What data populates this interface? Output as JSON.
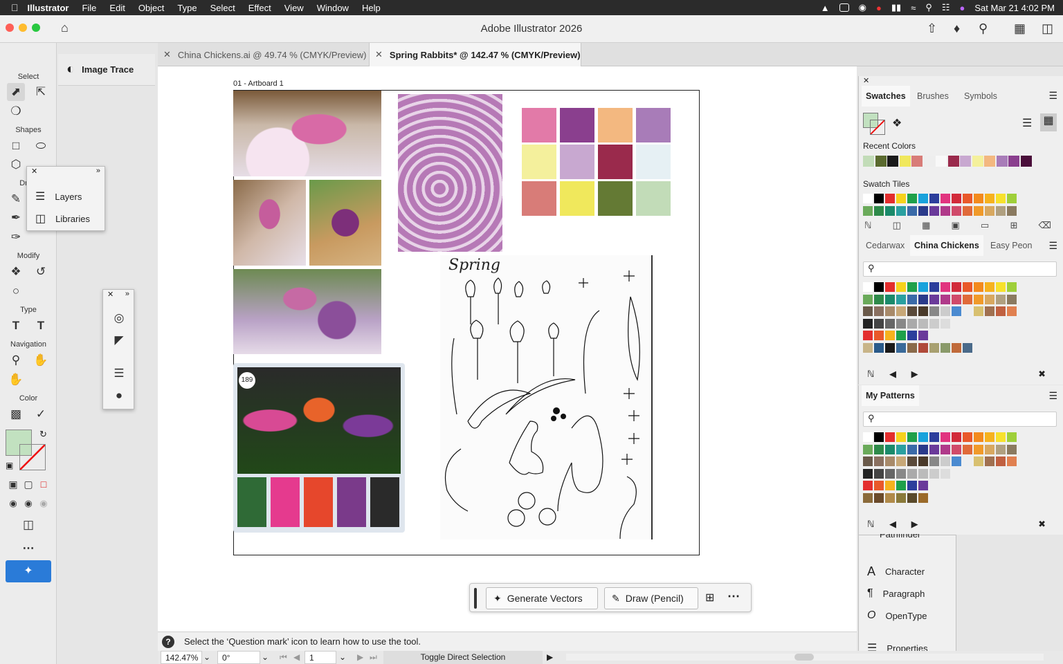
{
  "menubar": {
    "app": "Illustrator",
    "items": [
      "File",
      "Edit",
      "Object",
      "Type",
      "Select",
      "Effect",
      "View",
      "Window",
      "Help"
    ],
    "datetime": "Sat Mar 21  4:02 PM"
  },
  "window": {
    "title": "Adobe Illustrator 2026"
  },
  "tabs": [
    {
      "label": "China Chickens.ai @ 49.74 % (CMYK/Preview)"
    },
    {
      "label": "Spring Rabbits* @ 142.47 % (CMYK/Preview)"
    }
  ],
  "toolbar": {
    "sections": {
      "select": "Select",
      "shapes": "Shapes",
      "draw": "Dr",
      "modify": "Modify",
      "type": "Type",
      "navigation": "Navigation",
      "color": "Color"
    },
    "colors": {
      "fill": "#c2e1c0",
      "stroke": "none"
    }
  },
  "properties": {
    "image_trace": "Image Trace"
  },
  "layers_panel": {
    "layers": "Layers",
    "libraries": "Libraries"
  },
  "artboard": {
    "name": "01 - Artboard 1",
    "sketch_title": "Spring",
    "badge": "189"
  },
  "moodboard_swatches": [
    "#e27aa8",
    "#8a3f8e",
    "#f3b880",
    "#a87cb8",
    "#f4f09c",
    "#c8a8d0",
    "#9a2a4c",
    "#e6f0f4",
    "#d87c78",
    "#f0e85c",
    "#647a34",
    "#c2dcb8"
  ],
  "photo_card_swatches": [
    "#2f6a36",
    "#e53a8e",
    "#e6472c",
    "#7a3a8a",
    "#2a2a2a"
  ],
  "swatches_panel": {
    "tabs": [
      "Swatches",
      "Brushes",
      "Symbols"
    ],
    "recent_label": "Recent Colors",
    "recent": [
      "#c2dcb8",
      "#5a6a2e",
      "#1a1a1a",
      "#f0e85c",
      "#d87c78",
      "#eeeeee",
      "#f8f8f8",
      "#9a2a4c",
      "#c8a8d0",
      "#f4f09c",
      "#f3b880",
      "#a87cb8",
      "#8a3f8e",
      "#4a0e3a"
    ],
    "tiles_label": "Swatch Tiles"
  },
  "library_panel": {
    "tabs": [
      "Cedarwax",
      "China Chickens",
      "Easy Peon"
    ]
  },
  "patterns_panel": {
    "title": "My Patterns"
  },
  "type_panels": {
    "character": "Character",
    "paragraph": "Paragraph",
    "opentype": "OpenType",
    "properties": "Properties",
    "pathfinder": "Pathfinder"
  },
  "context_bar": {
    "generate": "Generate Vectors",
    "draw": "Draw (Pencil)"
  },
  "statusbar": {
    "hint": "Select the ‘Question mark’ icon to learn how to use the tool."
  },
  "bottombar": {
    "zoom": "142.47%",
    "rotation": "0°",
    "artboard": "1",
    "toggle": "Toggle Direct Selection"
  }
}
